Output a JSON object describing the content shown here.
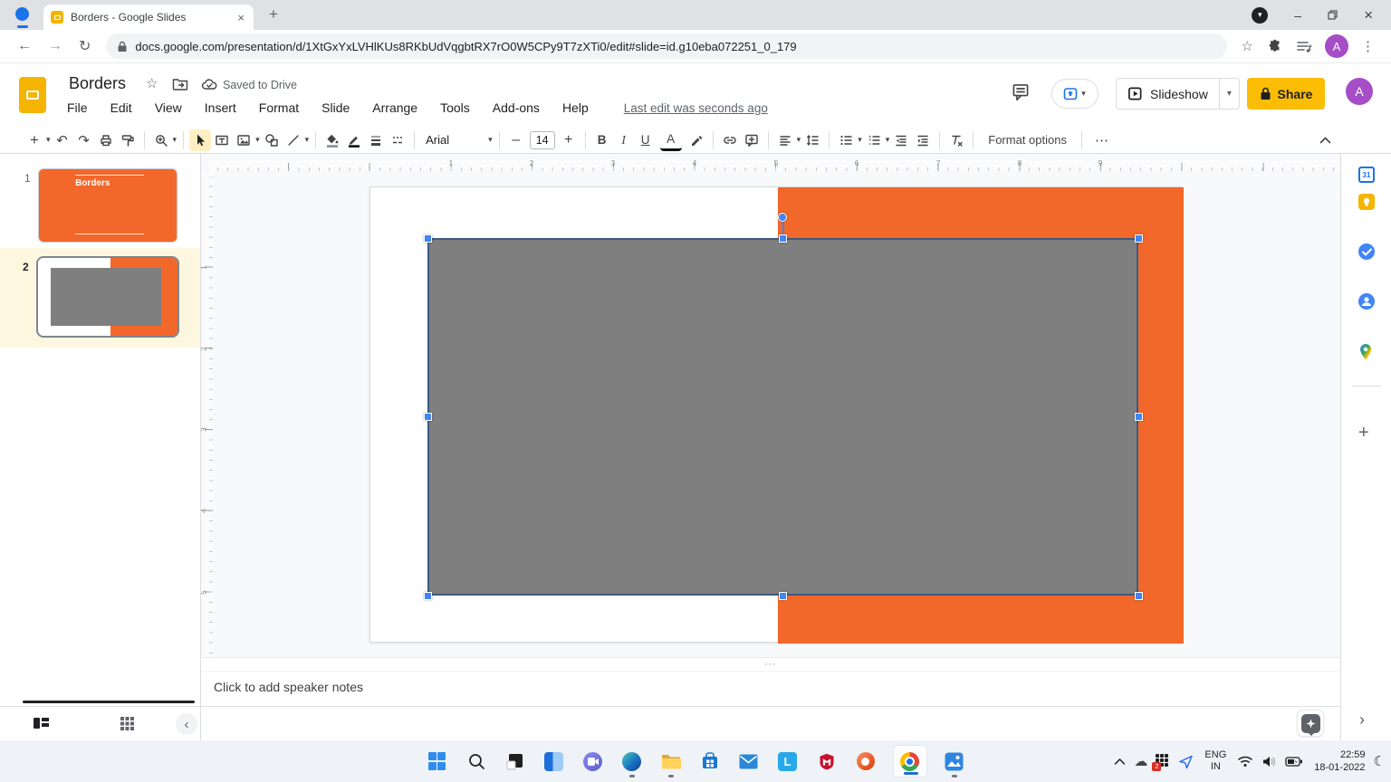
{
  "browser": {
    "tab_title": "Borders - Google Slides",
    "url": "docs.google.com/presentation/d/1XtGxYxLVHlKUs8RKbUdVqgbtRX7rO0W5CPy9T7zXTi0/edit#slide=id.g10eba072251_0_179"
  },
  "header": {
    "title": "Borders",
    "saved_status": "Saved to Drive",
    "menus": [
      "File",
      "Edit",
      "View",
      "Insert",
      "Format",
      "Slide",
      "Arrange",
      "Tools",
      "Add-ons",
      "Help"
    ],
    "last_edit": "Last edit was seconds ago",
    "slideshow_label": "Slideshow",
    "share_label": "Share",
    "avatar_letter": "A"
  },
  "toolbar": {
    "font_family": "Arial",
    "font_size": "14",
    "bold": "B",
    "italic": "I",
    "underline": "U",
    "text_color": "A",
    "format_options": "Format options"
  },
  "filmstrip": {
    "slides": [
      {
        "number": "1",
        "title": "Borders"
      },
      {
        "number": "2",
        "title": ""
      }
    ]
  },
  "canvas": {
    "h_ruler": [
      "1",
      "2",
      "3",
      "4",
      "5",
      "6",
      "7",
      "8",
      "9"
    ],
    "v_ruler": [
      "1",
      "2",
      "3",
      "4",
      "5"
    ]
  },
  "notes": {
    "placeholder": "Click to add speaker notes"
  },
  "sidebar": {
    "calendar_day": "31"
  },
  "tray": {
    "language": "ENG",
    "region": "IN",
    "time": "22:59",
    "date": "18-01-2022",
    "notification_badge": "2"
  },
  "icons": {
    "plus": "+",
    "dropdown_caret": "▾",
    "undo": "↶",
    "redo": "↷",
    "star_outline": "☆",
    "more_horizontal": "⋯",
    "more_vertical": "⋮",
    "minimize": "–",
    "close": "×",
    "back_arrow": "←",
    "forward_arrow": "→",
    "reload": "↻",
    "chevron_left": "‹",
    "chevron_right": "›",
    "cloud": "☁",
    "moon": "☾",
    "notes_handle": "⋯"
  },
  "colors": {
    "slide_orange": "#F2672A",
    "shape_gray": "#7F7F7F",
    "selection_blue": "#4285F4",
    "share_yellow": "#FBBC04",
    "avatar_purple": "#A64DC8",
    "selected_row_bg": "#FEF7E0"
  }
}
